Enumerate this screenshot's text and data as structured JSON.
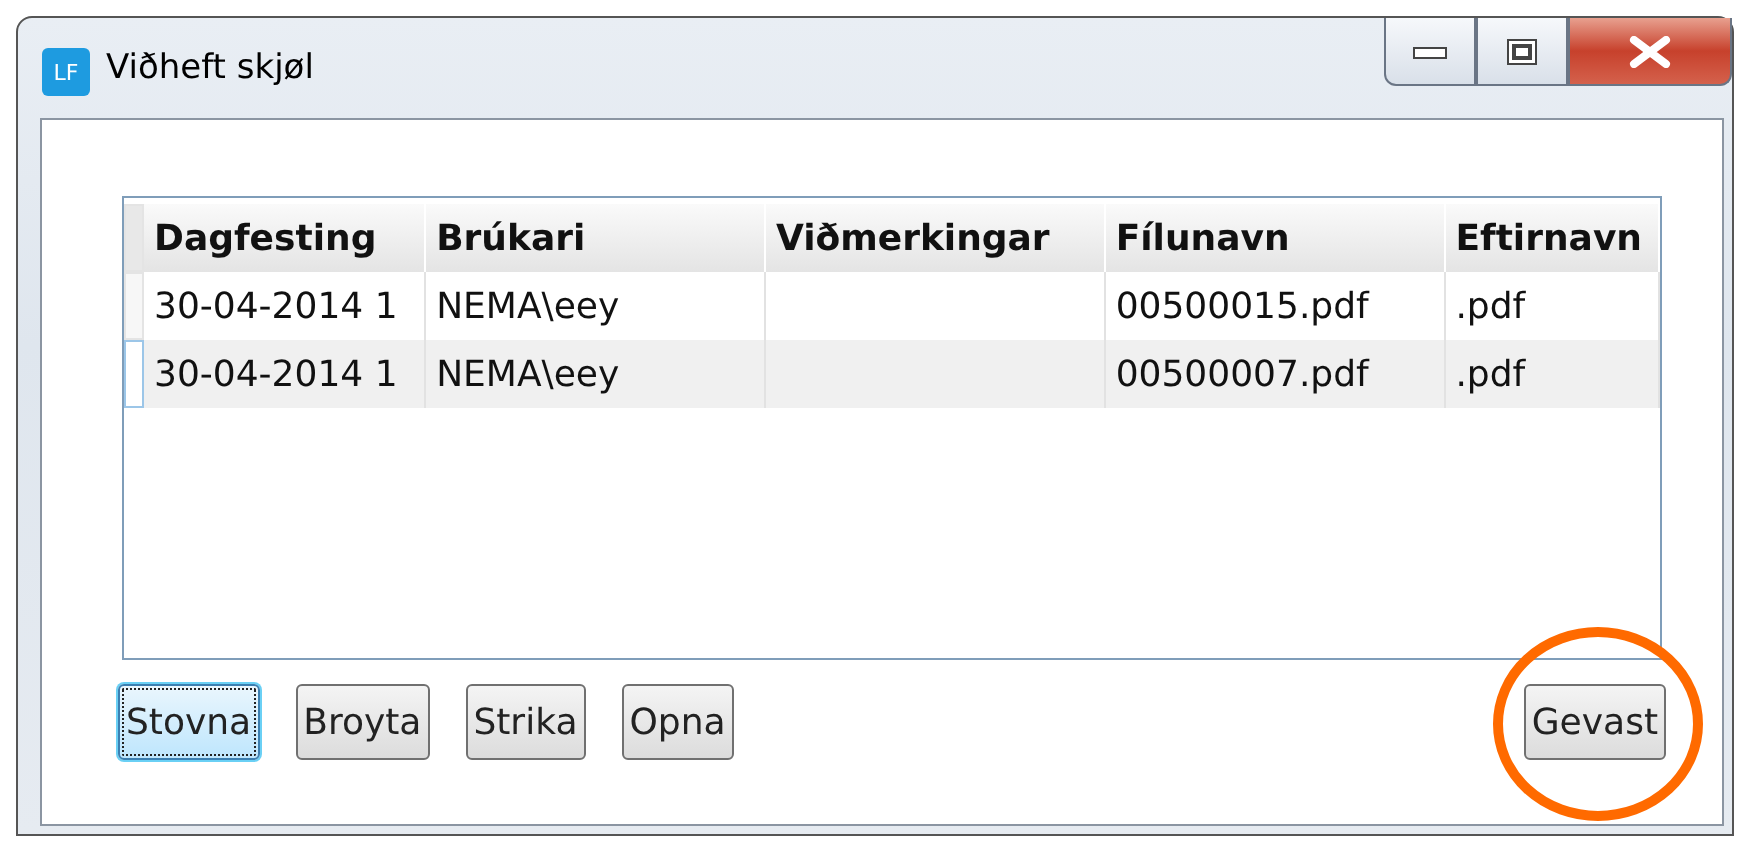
{
  "window": {
    "title": "Viðheft skjøl",
    "app_badge": "LF"
  },
  "table": {
    "columns": [
      "Dagfesting",
      "Brúkari",
      "Viðmerkingar",
      "Fílunavn",
      "Eftirnavn"
    ],
    "rows": [
      {
        "cells": [
          "30-04-2014 1",
          "NEMA\\eey",
          "",
          "00500015.pdf",
          ".pdf"
        ],
        "current": false
      },
      {
        "cells": [
          "30-04-2014 1",
          "NEMA\\eey",
          "",
          "00500007.pdf",
          ".pdf"
        ],
        "current": true
      }
    ]
  },
  "buttons": [
    {
      "label": "Stovna",
      "focused": true
    },
    {
      "label": "Broyta",
      "focused": false
    },
    {
      "label": "Strika",
      "focused": false
    },
    {
      "label": "Opna",
      "focused": false
    }
  ],
  "close_button": {
    "label": "Gevast",
    "highlighted": true
  }
}
